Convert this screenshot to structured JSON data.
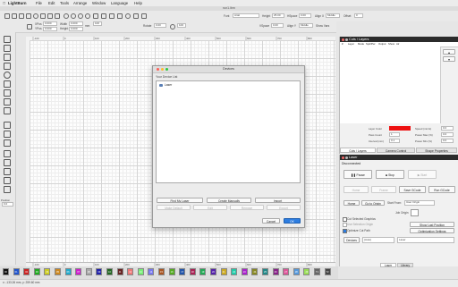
{
  "app": {
    "name": "LightBurn",
    "window_title": "run1.lbrn",
    "menu": [
      "File",
      "Edit",
      "Tools",
      "Arrange",
      "Window",
      "Language",
      "Help"
    ]
  },
  "toolbar": {
    "xpos_label": "XPos",
    "xpos_value": "0.000",
    "ypos_label": "YPos",
    "ypos_value": "0.000",
    "width_label": "Width",
    "width_value": "0.000",
    "height_label": "Height",
    "height_value": "0.000",
    "unit": "mm",
    "rotate_label": "Rotate",
    "rotate_value": "0.00",
    "percent": "100",
    "font_label": "Font",
    "font_value": "Arial",
    "height2_label": "Height",
    "height2_value": "25.00",
    "align_x_label": "Align X",
    "align_x_value": "Middle",
    "align_y_label": "Align Y",
    "align_y_value": "Middle",
    "offset_label": "Offset",
    "offset_value": "0",
    "hspace_label": "HSpace",
    "hspace_value": "0.00",
    "vspace_label": "VSpace",
    "vspace_value": "0.00",
    "show_vars_label": "Show Vars"
  },
  "rulers": {
    "top": [
      "-100",
      "0",
      "100",
      "200",
      "300",
      "400",
      "500",
      "600",
      "700",
      "800",
      "900"
    ],
    "bottom": [
      "-100",
      "0",
      "100",
      "200",
      "300",
      "400",
      "500",
      "600",
      "700",
      "800",
      "900"
    ]
  },
  "left_tools": {
    "position_label": "Position",
    "position_value": "0.0"
  },
  "palette": [
    {
      "label": "00",
      "color": "#111111"
    },
    {
      "label": "01",
      "color": "#2255cc"
    },
    {
      "label": "02",
      "color": "#cc2222"
    },
    {
      "label": "03",
      "color": "#22aa22"
    },
    {
      "label": "04",
      "color": "#cccc22"
    },
    {
      "label": "05",
      "color": "#cc8822"
    },
    {
      "label": "06",
      "color": "#22aacc"
    },
    {
      "label": "07",
      "color": "#cc22cc"
    },
    {
      "label": "08",
      "color": "#aaaaaa"
    },
    {
      "label": "09",
      "color": "#2222aa"
    },
    {
      "label": "10",
      "color": "#226622"
    },
    {
      "label": "11",
      "color": "#662222"
    },
    {
      "label": "12",
      "color": "#ee7777"
    },
    {
      "label": "13",
      "color": "#77ee77"
    },
    {
      "label": "14",
      "color": "#7777ee"
    },
    {
      "label": "15",
      "color": "#aa5522"
    },
    {
      "label": "16",
      "color": "#55aa22"
    },
    {
      "label": "17",
      "color": "#2255aa"
    },
    {
      "label": "18",
      "color": "#aa2255"
    },
    {
      "label": "19",
      "color": "#22aa55"
    },
    {
      "label": "20",
      "color": "#5522aa"
    },
    {
      "label": "21",
      "color": "#ccaa22"
    },
    {
      "label": "22",
      "color": "#22ccaa"
    },
    {
      "label": "23",
      "color": "#aa22cc"
    },
    {
      "label": "24",
      "color": "#888822"
    },
    {
      "label": "25",
      "color": "#228888"
    },
    {
      "label": "26",
      "color": "#882288"
    },
    {
      "label": "27",
      "color": "#dd5599"
    },
    {
      "label": "28",
      "color": "#5599dd"
    },
    {
      "label": "29",
      "color": "#99dd55"
    },
    {
      "label": "T1",
      "color": "#666666"
    },
    {
      "label": "T2",
      "color": "#444444"
    }
  ],
  "status": {
    "coords": "x: -133.26 mm, y: 259.60 mm"
  },
  "cuts_panel": {
    "title": "Cuts / Layers",
    "columns": [
      "#",
      "Layer",
      "Mode",
      "Spd/Pwr",
      "Output",
      "Show",
      "Air"
    ],
    "layer_color_label": "Layer Color",
    "speed_label": "Speed (mm/s)",
    "speed_value": "0.0",
    "pass_count_label": "Pass Count",
    "pass_count_value": "1",
    "interval_label": "Interval (mm)",
    "interval_value": "0.1",
    "power_max_label": "Power Max (%)",
    "power_max_value": "0.0",
    "power_min_label": "Power Min (%)",
    "power_min_value": "0.0",
    "layer_color": "#ee1111",
    "tabs": [
      "Cuts / Layers",
      "Camera Control",
      "Shape Properties"
    ]
  },
  "laser_panel": {
    "title": "Laser",
    "status": "Disconnected",
    "pause_label": "Pause",
    "stop_label": "Stop",
    "start_label": "Start",
    "home_label": "Home",
    "frame1_label": "Frame",
    "frame2_label": "Frame",
    "save_gcode_label": "Save GCode",
    "run_gcode_label": "Run GCode",
    "home2_label": "Home",
    "go_to_origin_label": "Go to Origin",
    "start_from_label": "Start From:",
    "start_from_value": "User Origin",
    "job_origin_label": "Job Origin",
    "cut_selected_label": "Cut Selected Graphics",
    "use_selection_origin_label": "Use Selection Origin",
    "show_last_position_label": "Show Last Position",
    "optimize_cut_path_label": "Optimize Cut Path",
    "optimization_settings_label": "Optimization Settings",
    "devices_label": "Devices",
    "devices_value": "(Auto)",
    "laser_select_value": "Laser"
  },
  "bottom_tabs": [
    "Laser",
    "Library"
  ],
  "dialog": {
    "title": "Devices",
    "list_label": "Your Device List",
    "device": "Laser",
    "find_my_laser": "Find My Laser",
    "create_manually": "Create Manually",
    "import": "Import",
    "make_default": "Make Default",
    "edit": "Edit",
    "remove": "Remove",
    "export": "Export",
    "cancel": "Cancel",
    "ok": "OK"
  }
}
